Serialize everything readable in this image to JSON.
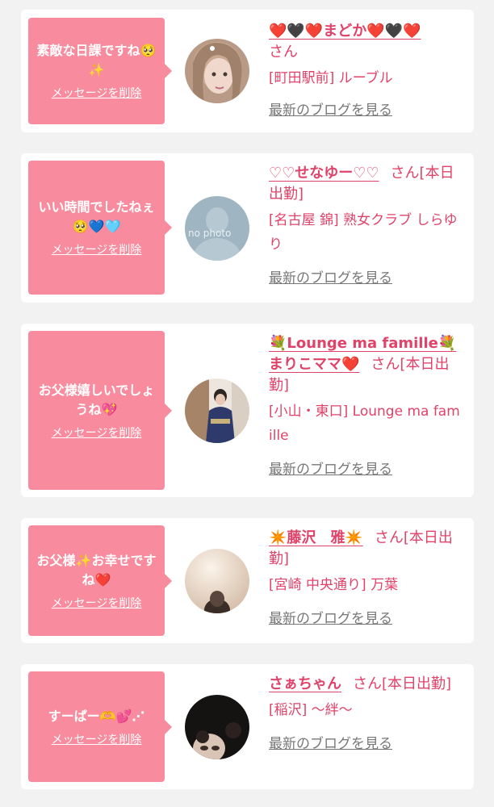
{
  "items": [
    {
      "message": "素敵な日課ですね🥺✨",
      "delete_label": "メッセージを削除",
      "name": "❤️🖤❤️まどか❤️🖤❤️",
      "san": "さん",
      "status": "",
      "shop": "[町田駅前] ルーブル",
      "blog_link": "最新のブログを見る",
      "avatar_icon": "portrait-blonde-avatar"
    },
    {
      "message": "いい時間でしたねぇ🥺💙🩵",
      "delete_label": "メッセージを削除",
      "name": "♡♡せなゆー♡♡",
      "san": "さん",
      "status": "[本日出勤]",
      "shop": "[名古屋 錦] 熟女クラブ しらゆり",
      "blog_link": "最新のブログを見る",
      "avatar_icon": "no-photo-avatar",
      "avatar_text": "no photo"
    },
    {
      "message": "お父様嬉しいでしょうね💖",
      "delete_label": "メッセージを削除",
      "name": "💐Lounge ma famille💐まりこママ❤️",
      "san": "さん",
      "status": "[本日出勤]",
      "shop": "[小山・東口] Lounge ma famille",
      "blog_link": "最新のブログを見る",
      "avatar_icon": "kimono-woman-avatar"
    },
    {
      "message": "お父様✨お幸せですね❤️",
      "delete_label": "メッセージを削除",
      "name": "✴️藤沢　雅✴️",
      "san": "さん",
      "status": "[本日出勤]",
      "shop": "[宮崎 中央通り] 万葉",
      "blog_link": "最新のブログを見る",
      "avatar_icon": "soft-light-portrait-avatar"
    },
    {
      "message": "すーぱー🫶💕⋰",
      "delete_label": "メッセージを削除",
      "name": "さぁちゃん",
      "san": "さん",
      "status": "[本日出勤]",
      "shop": "[稲沢] 〜絆〜",
      "blog_link": "最新のブログを見る",
      "avatar_icon": "dark-portrait-avatar"
    }
  ],
  "colors": {
    "bubble": "#f88b9d",
    "accent": "#e0436a",
    "link_gray": "#777777",
    "background": "#f2f2f2"
  }
}
